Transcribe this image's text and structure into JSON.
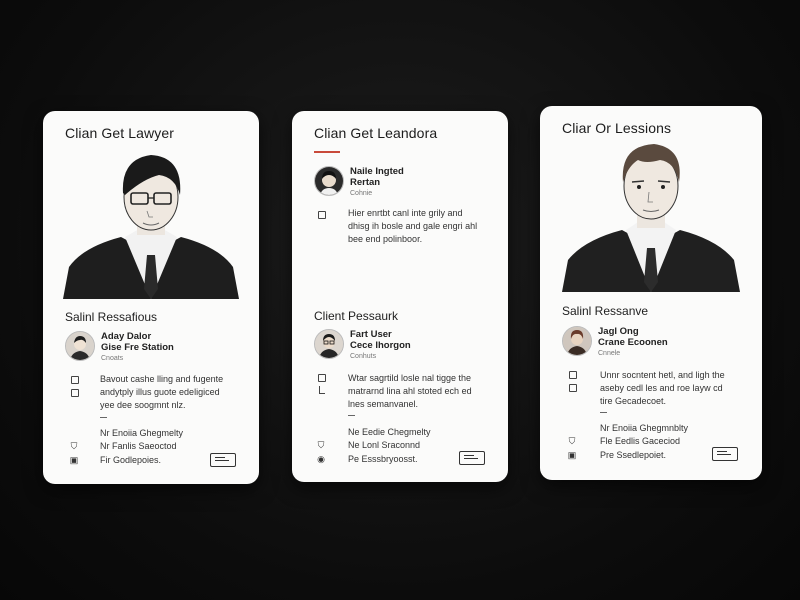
{
  "cards": [
    {
      "title": "Clian Get Lawyer",
      "section_title": "Salinl Ressafious",
      "contact": {
        "name": "Aday Dalor",
        "role": "Gise Fre Station",
        "meta": "Cnoats"
      },
      "description": [
        "Bavout cashe lling and fugente",
        "andytply illus guote edeligiced",
        "yee dee soogmnt nlz."
      ],
      "rows": [
        {
          "icon": "",
          "text": "Nr Enoiia Ghegmelty"
        },
        {
          "icon": "shield-check-icon",
          "glyph": "⛉",
          "text": "Nr Fanlis Saeoctod"
        },
        {
          "icon": "clipboard-icon",
          "glyph": "▣",
          "text": "Fir Godlepoies."
        }
      ]
    },
    {
      "title": "Clian Get Leandora",
      "contact_top": {
        "name": "Naile Ingted",
        "role": "Rertan",
        "meta": "Cohnie"
      },
      "description_top": [
        "Hier enrtbt canl inte grily and",
        "dhisg ih bosle and gale engri ahl",
        "bee end polinboor."
      ],
      "section_title": "Client Pessaurk",
      "contact": {
        "name": "Fart User",
        "role": "Cece lhorgon",
        "meta": "Conhuts"
      },
      "description": [
        "Wtar sagrtild losle nal tigge the",
        "matrarnd lina ahl stoted ech ed",
        "lnes semanvanel."
      ],
      "rows": [
        {
          "icon": "",
          "text": "Ne Eedie Chegmelty"
        },
        {
          "icon": "shield-check-icon",
          "glyph": "⛉",
          "text": "Ne Lonl Sraconnd"
        },
        {
          "icon": "target-icon",
          "glyph": "◉",
          "text": "Pe Esssbryoosst."
        }
      ]
    },
    {
      "title": "Cliar Or Lessions",
      "section_title": "Salinl Ressanve",
      "contact": {
        "name": "Jagl Ong",
        "role": "Crane Ecoonen",
        "meta": "Cnnele"
      },
      "description": [
        "Unnr socntent hetl, and ligh the",
        "aseby cedl les and roe layw cd",
        "tire Gecadecoet."
      ],
      "rows": [
        {
          "icon": "",
          "text": "Nr Enoiia Ghegmnblty"
        },
        {
          "icon": "shield-check-icon",
          "glyph": "⛉",
          "text": "Fle Eedlis Gaceciod"
        },
        {
          "icon": "clipboard-icon",
          "glyph": "▣",
          "text": "Pre Ssedlepoiet."
        }
      ]
    }
  ],
  "icons": [
    "checkbox-icon",
    "shield-check-icon",
    "clipboard-icon",
    "target-icon",
    "id-card-icon"
  ],
  "colors": {
    "background": "#0c0c0c",
    "card": "#fbfbfa",
    "accent": "#c94a3a",
    "ink": "#222222"
  }
}
